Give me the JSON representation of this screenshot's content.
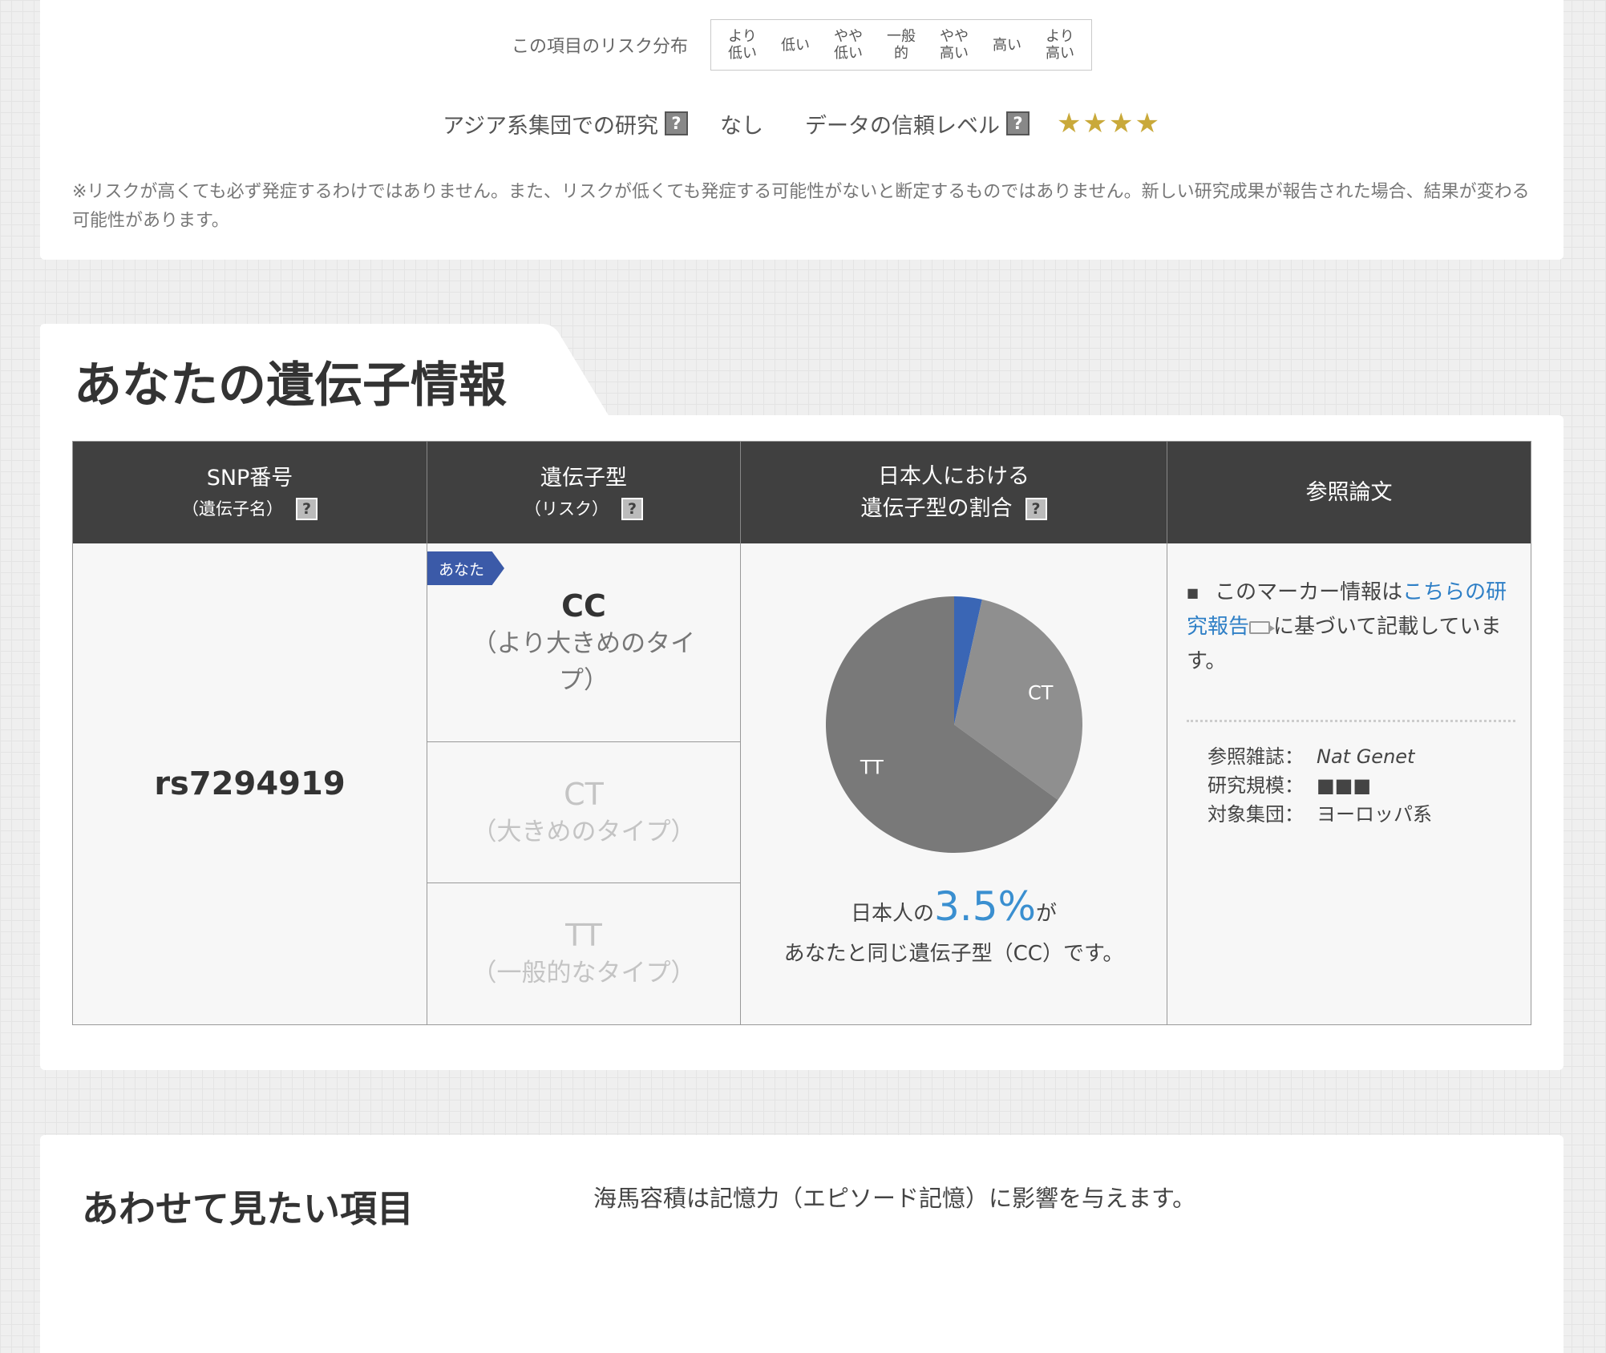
{
  "risk_distribution": {
    "label": "この項目のリスク分布",
    "levels": [
      "より\n低い",
      "低い",
      "やや\n低い",
      "一般\n的",
      "やや\n高い",
      "高い",
      "より\n高い"
    ]
  },
  "study_info": {
    "asian_label": "アジア系集団での研究",
    "asian_value": "なし",
    "reliability_label": "データの信頼レベル",
    "reliability_stars": "★★★★",
    "help_glyph": "?"
  },
  "disclaimer": "※リスクが高くても必ず発症するわけではありません。また、リスクが低くても発症する可能性がないと断定するものではありません。新しい研究成果が報告された場合、結果が変わる可能性があります。",
  "gene_section": {
    "title": "あなたの遺伝子情報",
    "headers": {
      "snp": "SNP番号",
      "snp_sub": "（遺伝子名）",
      "genotype": "遺伝子型",
      "genotype_sub": "（リスク）",
      "ratio_line1": "日本人における",
      "ratio_line2": "遺伝子型の割合",
      "reference": "参照論文"
    },
    "snp_id": "rs7294919",
    "you_tag": "あなた",
    "genotypes": [
      {
        "name": "CC",
        "desc": "（より大きめのタイプ）",
        "active": true
      },
      {
        "name": "CT",
        "desc": "（大きめのタイプ）",
        "active": false
      },
      {
        "name": "TT",
        "desc": "（一般的なタイプ）",
        "active": false
      }
    ],
    "caption_prefix": "日本人の",
    "caption_pct": "3.5%",
    "caption_suffix": "が",
    "caption_line2": "あなたと同じ遺伝子型（CC）です。",
    "reference": {
      "text_before": "このマーカー情報は",
      "link_text": "こちらの研究報告",
      "text_after": "に基づいて記載しています。",
      "journal_label": "参照雑誌：",
      "journal_value": "Nat Genet",
      "scale_label": "研究規模：",
      "scale_value": "■■■",
      "population_label": "対象集団：",
      "population_value": "ヨーロッパ系"
    }
  },
  "chart_data": {
    "type": "pie",
    "slices": [
      {
        "label": "",
        "value": 3.5,
        "color": "#3a66b5"
      },
      {
        "label": "CT",
        "value": 31.5,
        "color": "#8f8f8f"
      },
      {
        "label": "TT",
        "value": 65.0,
        "color": "#797979"
      }
    ]
  },
  "related": {
    "title": "あわせて見たい項目",
    "text": "海馬容積は記憶力（エピソード記憶）に影響を与えます。"
  }
}
